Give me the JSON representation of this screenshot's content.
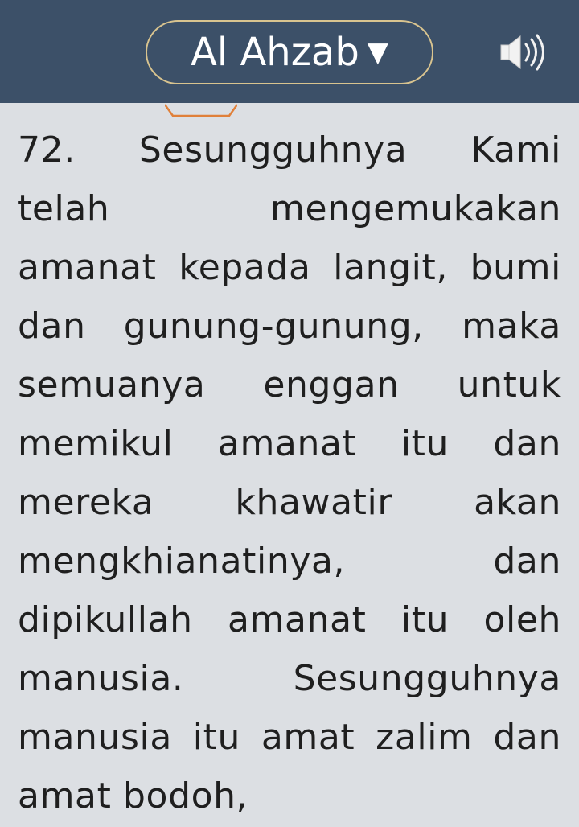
{
  "header": {
    "surah_name": "Al Ahzab",
    "caret": "▼",
    "audio_icon": "speaker-icon"
  },
  "verse": {
    "lines": [
      [
        "72.",
        "Sesungguhnya",
        "Kami"
      ],
      [
        "telah",
        "mengemukakan"
      ],
      [
        "amanat",
        "kepada",
        "langit,",
        "bumi"
      ],
      [
        "dan",
        "gunung-gunung,",
        "maka"
      ],
      [
        "semuanya",
        "enggan",
        "untuk"
      ],
      [
        "memikul",
        "amanat",
        "itu",
        "dan"
      ],
      [
        "mereka",
        "khawatir",
        "akan"
      ],
      [
        "mengkhianatinya,",
        "dan"
      ],
      [
        "dipikullah",
        "amanat",
        "itu",
        "oleh"
      ],
      [
        "manusia.",
        "Sesungguhnya"
      ],
      [
        "manusia",
        "itu",
        "amat",
        "zalim",
        "dan"
      ],
      [
        "amat bodoh,"
      ]
    ]
  },
  "colors": {
    "header_bg": "#3c5068",
    "pill_border": "#d9c48f",
    "content_bg": "#dcdfe3",
    "tab_marker": "#e0803a"
  }
}
